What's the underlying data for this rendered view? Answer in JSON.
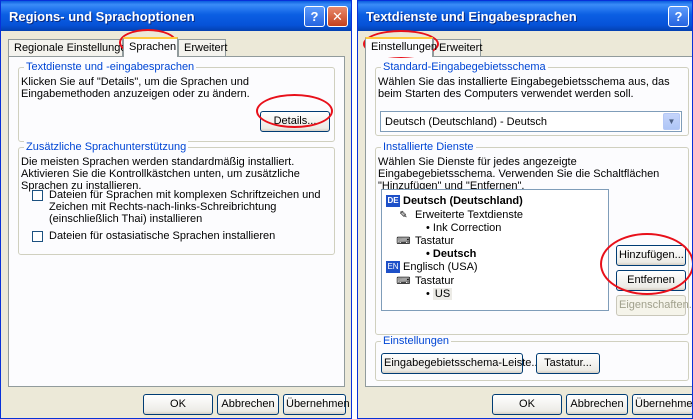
{
  "left": {
    "title": "Regions- und Sprachoptionen",
    "help": "?",
    "close": "✕",
    "tabs": [
      "Regionale Einstellungen",
      "Sprachen",
      "Erweitert"
    ],
    "group1": {
      "legend": "Textdienste und -eingabesprachen",
      "text": "Klicken Sie auf \"Details\", um die Sprachen und Eingabemethoden anzuzeigen oder zu ändern.",
      "details": "Details..."
    },
    "group2": {
      "legend": "Zusätzliche Sprachunterstützung",
      "text": "Die meisten Sprachen werden standardmäßig installiert. Aktivieren Sie die Kontrollkästchen unten, um zusätzliche Sprachen zu installieren.",
      "check1": "Dateien für Sprachen mit komplexen Schriftzeichen und Zeichen mit Rechts-nach-links-Schreibrichtung (einschließlich Thai) installieren",
      "check2": "Dateien für ostasiatische Sprachen installieren"
    },
    "buttons": {
      "ok": "OK",
      "cancel": "Abbrechen",
      "apply": "Übernehmen"
    }
  },
  "right": {
    "title": "Textdienste und Eingabesprachen",
    "help": "?",
    "tabs": [
      "Einstellungen",
      "Erweitert"
    ],
    "default": {
      "legend": "Standard-Eingabegebietsschema",
      "text": "Wählen Sie das installierte Eingabegebietsschema aus, das beim Starten des Computers verwendet werden soll.",
      "value": "Deutsch (Deutschland) - Deutsch"
    },
    "installed": {
      "legend": "Installierte Dienste",
      "text": "Wählen Sie Dienste für jedes angezeigte Eingabegebietsschema. Verwenden Sie die Schaltflächen \"Hinzufügen\" und \"Entfernen\".",
      "tree": {
        "de_flag": "DE",
        "de_label": "Deutsch (Deutschland)",
        "ext_label": "Erweiterte Textdienste",
        "ink": "Ink Correction",
        "kb1_label": "Tastatur",
        "kb1_value": "Deutsch",
        "en_flag": "EN",
        "en_label": "Englisch (USA)",
        "kb2_label": "Tastatur",
        "kb2_value": "US"
      },
      "add": "Hinzufügen...",
      "remove": "Entfernen",
      "props": "Eigenschaften..."
    },
    "settings": {
      "legend": "Einstellungen",
      "langbar": "Eingabegebietsschema-Leiste...",
      "keyboard": "Tastatur..."
    },
    "buttons": {
      "ok": "OK",
      "cancel": "Abbrechen",
      "apply": "Übernehmen"
    }
  },
  "colors": {
    "title_blue": "#0652d8",
    "accent_red": "#e8101a",
    "legend_blue": "#0046d5"
  },
  "icons": [
    "help-icon",
    "close-icon",
    "dropdown-arrow-icon",
    "flag-de-icon",
    "flag-en-icon",
    "text-service-icon",
    "keyboard-icon",
    "bullet-icon"
  ]
}
